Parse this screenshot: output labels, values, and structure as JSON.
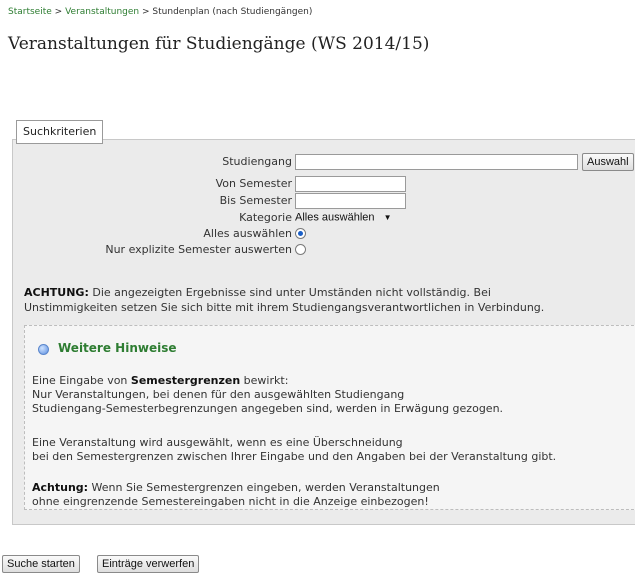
{
  "breadcrumb": {
    "home": "Startseite",
    "events": "Veranstaltungen",
    "separator": ">",
    "current": "Stundenplan (nach Studiengängen)"
  },
  "page_title": "Veranstaltungen für Studiengänge (WS 2014/15)",
  "search": {
    "legend": "Suchkriterien",
    "studiengang_label": "Studiengang",
    "studiengang_value": "",
    "auswahl_button": "Auswahl",
    "von_semester_label": "Von Semester",
    "von_semester_value": "",
    "bis_semester_label": "Bis Semester",
    "bis_semester_value": "",
    "kategorie_label": "Kategorie",
    "kategorie_selected": "Alles auswählen",
    "radio_all_label": "Alles auswählen",
    "radio_explicit_label": "Nur explizite Semester auswerten",
    "selected_radio": "all"
  },
  "warning": {
    "strong": "ACHTUNG:",
    "line1": " Die angezeigten Ergebnisse sind unter Umständen nicht vollständig. Bei",
    "line2": "Unstimmigkeiten setzen Sie sich bitte mit ihrem Studiengangsverantwortlichen in Verbindung."
  },
  "hints": {
    "title": "Weitere Hinweise",
    "p1_prefix": "Eine Eingabe von ",
    "p1_bold": "Semestergrenzen",
    "p1_suffix": " bewirkt:",
    "p1_line2": "Nur Veranstaltungen, bei denen für den ausgewählten Studiengang",
    "p1_line3": "Studiengang-Semesterbegrenzungen angegeben sind, werden in Erwägung gezogen.",
    "p2_line1": "Eine Veranstaltung wird ausgewählt, wenn es eine Überschneidung",
    "p2_line2": "bei den Semestergrenzen zwischen Ihrer Eingabe und den Angaben bei der Veranstaltung gibt.",
    "p3_bold": "Achtung:",
    "p3_line1": " Wenn Sie Semestergrenzen eingeben, werden Veranstaltungen",
    "p3_line2": "ohne eingrenzende Semestereingaben nicht in die Anzeige einbezogen!"
  },
  "buttons": {
    "search": "Suche starten",
    "reset": "Einträge verwerfen"
  }
}
